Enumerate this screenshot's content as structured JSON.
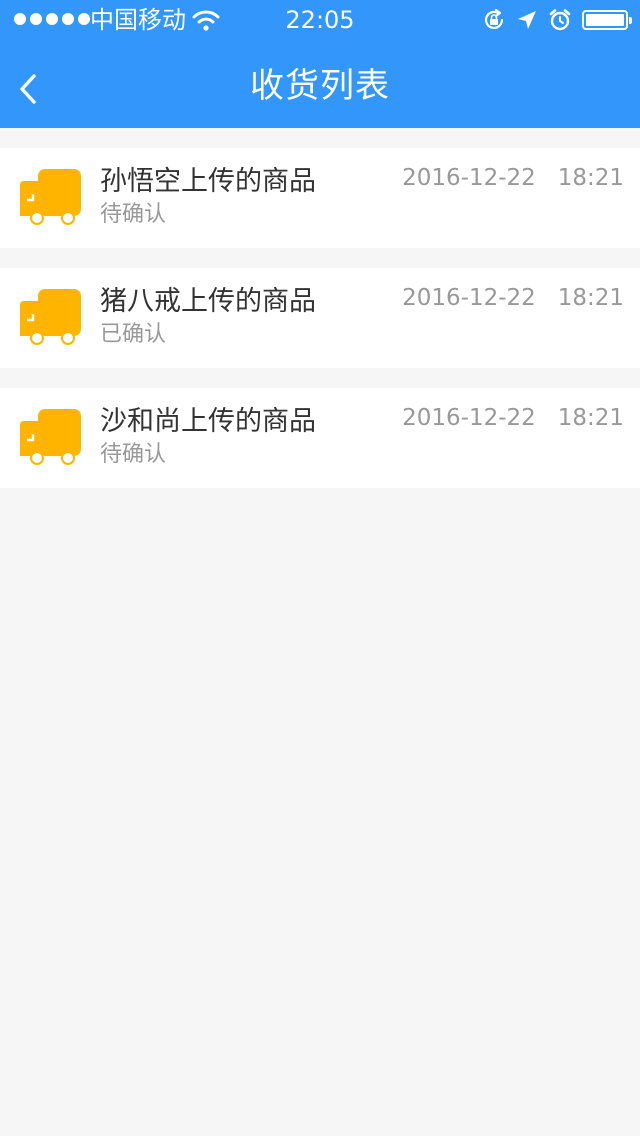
{
  "status_bar": {
    "carrier": "中国移动",
    "time": "22:05",
    "signal_dots": 5
  },
  "nav": {
    "title": "收货列表"
  },
  "items": [
    {
      "title": "孙悟空上传的商品",
      "status": "待确认",
      "datetime": "2016-12-22   18:21"
    },
    {
      "title": "猪八戒上传的商品",
      "status": "已确认",
      "datetime": "2016-12-22   18:21"
    },
    {
      "title": "沙和尚上传的商品",
      "status": "待确认",
      "datetime": "2016-12-22   18:21"
    }
  ],
  "icons": {
    "truck": "truck-icon",
    "back": "chevron-left-icon"
  },
  "colors": {
    "primary": "#3296fa",
    "truck": "#ffb400",
    "background": "#f6f6f6"
  }
}
